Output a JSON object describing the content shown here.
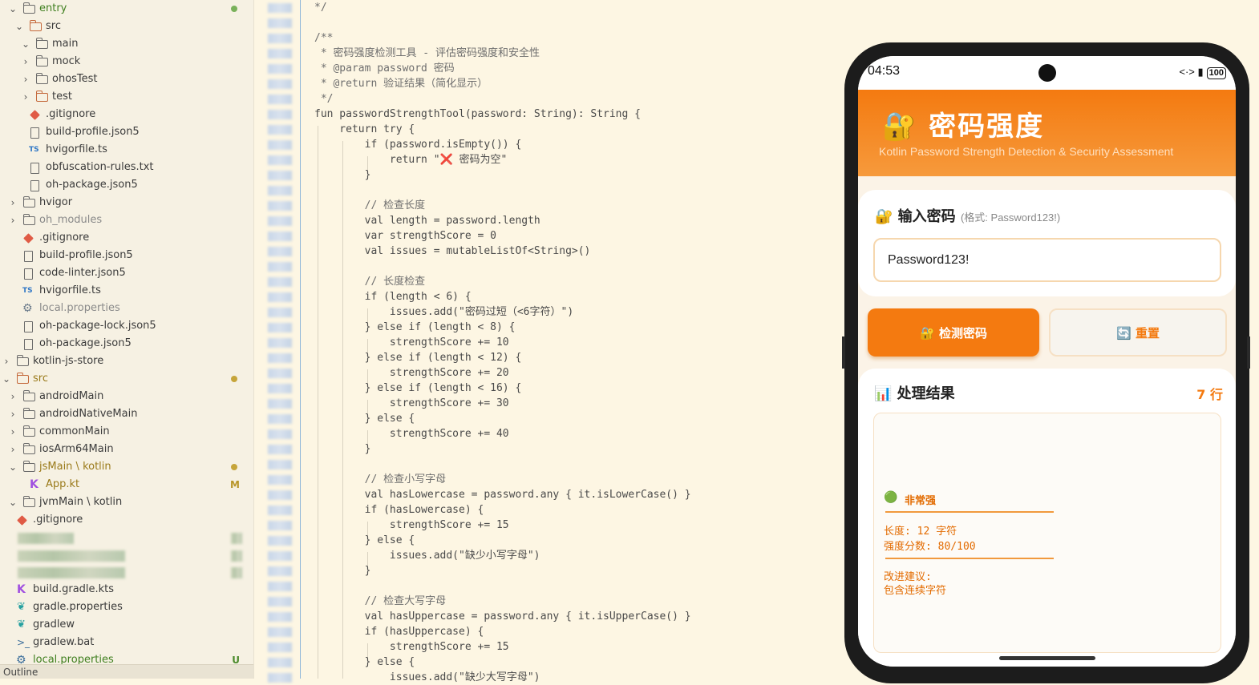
{
  "explorer": {
    "items": [
      {
        "label": "entry",
        "color": "#4a8a2a"
      },
      {
        "label": "src"
      },
      {
        "label": "main"
      },
      {
        "label": "mock"
      },
      {
        "label": "ohosTest"
      },
      {
        "label": "test"
      },
      {
        "label": ".gitignore"
      },
      {
        "label": "build-profile.json5"
      },
      {
        "label": "hvigorfile.ts"
      },
      {
        "label": "obfuscation-rules.txt"
      },
      {
        "label": "oh-package.json5"
      },
      {
        "label": "hvigor"
      },
      {
        "label": "oh_modules"
      },
      {
        "label": ".gitignore"
      },
      {
        "label": "build-profile.json5"
      },
      {
        "label": "code-linter.json5"
      },
      {
        "label": "hvigorfile.ts"
      },
      {
        "label": "local.properties"
      },
      {
        "label": "oh-package-lock.json5"
      },
      {
        "label": "oh-package.json5"
      },
      {
        "label": "kotlin-js-store"
      },
      {
        "label": "src"
      },
      {
        "label": "androidMain"
      },
      {
        "label": "androidNativeMain"
      },
      {
        "label": "commonMain"
      },
      {
        "label": "iosArm64Main"
      },
      {
        "label": "jsMain \\ kotlin"
      },
      {
        "label": "App.kt",
        "badge": "M"
      },
      {
        "label": "jvmMain \\ kotlin"
      },
      {
        "label": ".gitignore"
      },
      {
        "label": "build.gradle.kts"
      },
      {
        "label": "gradle.properties"
      },
      {
        "label": "gradlew"
      },
      {
        "label": "gradlew.bat"
      },
      {
        "label": "local.properties",
        "badge": "U"
      }
    ],
    "outline_label": "Outline"
  },
  "code": {
    "lines": [
      "*/",
      "",
      "/**",
      " * 密码强度检测工具 - 评估密码强度和安全性",
      " * @param password 密码",
      " * @return 验证结果（简化显示）",
      " */",
      "fun passwordStrengthTool(password: String): String {",
      "    return try {",
      "        if (password.isEmpty()) {",
      "            return \"❌ 密码为空\"",
      "        }",
      "",
      "        // 检查长度",
      "        val length = password.length",
      "        var strengthScore = 0",
      "        val issues = mutableListOf<String>()",
      "",
      "        // 长度检查",
      "        if (length < 6) {",
      "            issues.add(\"密码过短（<6字符）\")",
      "        } else if (length < 8) {",
      "            strengthScore += 10",
      "        } else if (length < 12) {",
      "            strengthScore += 20",
      "        } else if (length < 16) {",
      "            strengthScore += 30",
      "        } else {",
      "            strengthScore += 40",
      "        }",
      "",
      "        // 检查小写字母",
      "        val hasLowercase = password.any { it.isLowerCase() }",
      "        if (hasLowercase) {",
      "            strengthScore += 15",
      "        } else {",
      "            issues.add(\"缺少小写字母\")",
      "        }",
      "",
      "        // 检查大写字母",
      "        val hasUppercase = password.any { it.isUpperCase() }",
      "        if (hasUppercase) {",
      "            strengthScore += 15",
      "        } else {",
      "            issues.add(\"缺少大写字母\")"
    ]
  },
  "phone": {
    "time": "04:53",
    "status_icons": "<·> ▮",
    "battery": "100",
    "app_title": "🔐 密码强度",
    "app_subtitle": "Kotlin Password Strength Detection & Security Assessment",
    "input_section": {
      "title": "🔐 输入密码",
      "hint": "(格式: Password123!)",
      "value": "Password123!"
    },
    "buttons": {
      "check": "🔐 检测密码",
      "reset": "🔄 重置"
    },
    "result_section": {
      "title": "📊 处理结果",
      "row_count": "7 行"
    },
    "results": {
      "level_icon": "🟢",
      "level": "非常强",
      "length": "长度: 12 字符",
      "score": "强度分数: 80/100",
      "suggest_title": "改进建议:",
      "suggest": "包含连续字符"
    }
  },
  "colors": {
    "accent": "#f47a10",
    "editor_bg": "#fdf6e3",
    "explorer_bg": "#f6f1e3",
    "modified": "#c6a53a",
    "untracked": "#4a8a2a"
  }
}
